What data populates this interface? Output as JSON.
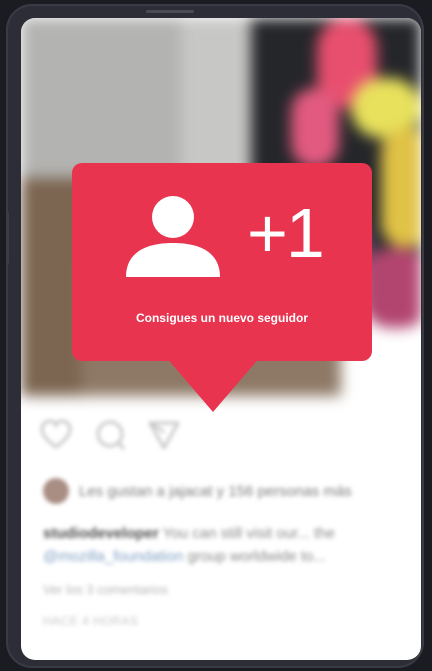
{
  "notification": {
    "count": "+1",
    "message": "Consigues un nuevo seguidor",
    "icon": "user-icon",
    "color": "#e8344f"
  },
  "post": {
    "likes_text": "Les gustan a jajacat y 156 personas más",
    "caption_user": "studiodeveloper",
    "caption_text": "You can still visit our... the",
    "caption_tag": "@mozilla_foundation",
    "caption_rest": "group worldwide to...",
    "comments_link": "Ver los 3 comentarios",
    "time_ago": "HACE 4 HORAS"
  },
  "icons": [
    "heart-icon",
    "comment-icon",
    "share-icon"
  ]
}
